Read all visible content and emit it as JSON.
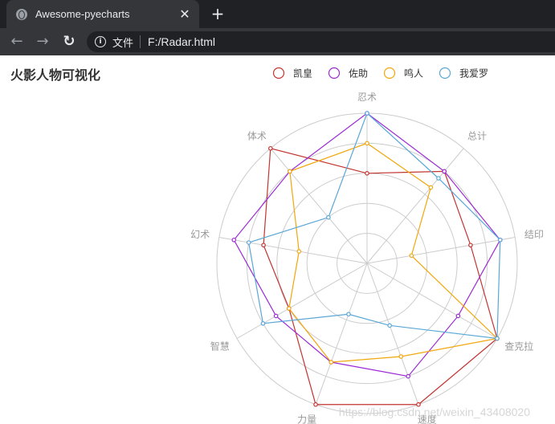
{
  "browser": {
    "tab_title": "Awesome-pyecharts",
    "tab_close_glyph": "✕",
    "new_tab_glyph": "+",
    "back_glyph": "←",
    "forward_glyph": "→",
    "reload_glyph": "↻",
    "info_glyph": "i",
    "url_label": "文件",
    "url": "F:/Radar.html"
  },
  "watermark": "https://blog.csdn.net/weixin_43408020",
  "chart_data": {
    "type": "radar",
    "title": "火影人物可视化",
    "indicators": [
      "忍术",
      "总计",
      "结印",
      "查克拉",
      "速度",
      "力量",
      "智慧",
      "幻术",
      "体术"
    ],
    "max": 5,
    "rings": 5,
    "legend_position": "top-center",
    "series": [
      {
        "name": "凯皇",
        "color": "#c23531",
        "values": [
          3,
          4,
          3.5,
          5,
          5,
          5,
          3,
          3.5,
          5
        ]
      },
      {
        "name": "佐助",
        "color": "#9b2bd4",
        "values": [
          5,
          4,
          4.5,
          3.5,
          4,
          3.5,
          3.5,
          4.5,
          4
        ]
      },
      {
        "name": "鸣人",
        "color": "#f2a60b",
        "values": [
          4,
          3.3,
          1.5,
          5,
          3.3,
          3.5,
          3,
          2.3,
          4
        ]
      },
      {
        "name": "我爱罗",
        "color": "#5aa7d6",
        "values": [
          5,
          3.7,
          4.5,
          5,
          2.2,
          1.8,
          4,
          4,
          2
        ]
      }
    ]
  }
}
